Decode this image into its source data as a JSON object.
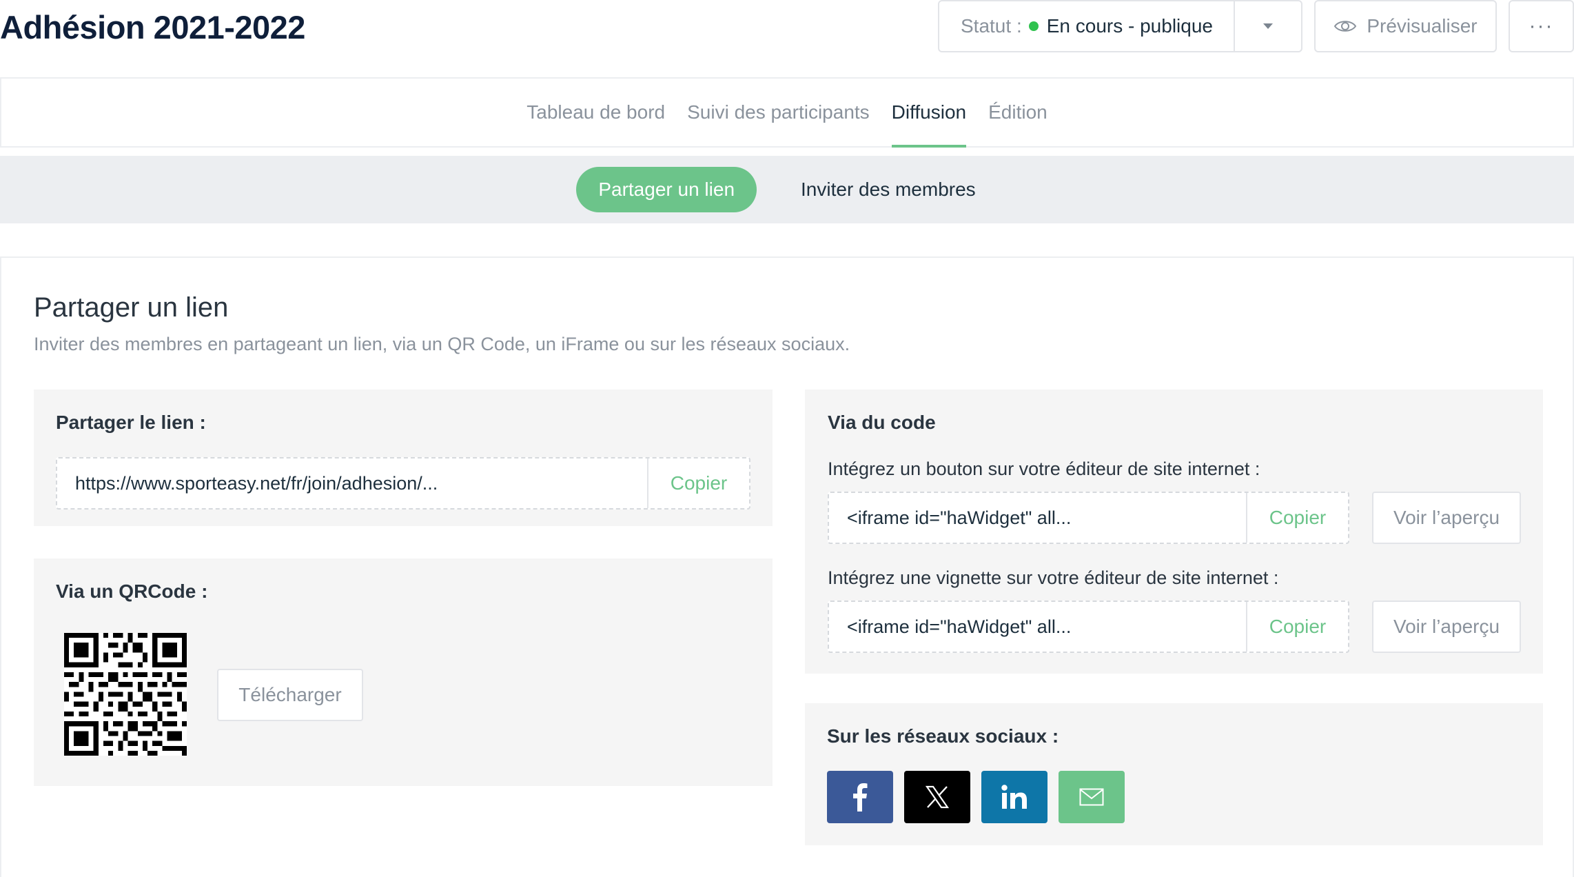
{
  "header": {
    "title": "Adhésion 2021-2022",
    "status_label": "Statut :",
    "status_value": "En cours - publique",
    "status_color": "#30c24f",
    "preview_label": "Prévisualiser",
    "more_label": "···"
  },
  "tabs": [
    {
      "label": "Tableau de bord",
      "active": false
    },
    {
      "label": "Suivi des participants",
      "active": false
    },
    {
      "label": "Diffusion",
      "active": true
    },
    {
      "label": "Édition",
      "active": false
    }
  ],
  "subnav": {
    "active_label": "Partager un lien",
    "other_label": "Inviter des membres"
  },
  "share": {
    "title": "Partager un lien",
    "subtitle": "Inviter des membres en partageant un lien, via un QR Code, un iFrame ou sur les réseaux sociaux.",
    "link_panel": {
      "label": "Partager le lien :",
      "value": "https://www.sporteasy.net/fr/join/adhesion/...",
      "copy_label": "Copier"
    },
    "qr_panel": {
      "label": "Via un QRCode :",
      "download_label": "Télécharger"
    },
    "code_panel": {
      "label": "Via du code",
      "button_label": "Intégrez un bouton sur votre éditeur de site internet :",
      "button_value": "<iframe id=\"haWidget\" all...",
      "vignette_label": "Intégrez une vignette sur votre éditeur de site internet :",
      "vignette_value": "<iframe id=\"haWidget\" all...",
      "copy_label": "Copier",
      "preview_label": "Voir l’aperçu"
    },
    "social_panel": {
      "label": "Sur les réseaux sociaux :",
      "networks": [
        {
          "icon": "facebook-icon",
          "color": "#3b5998"
        },
        {
          "icon": "x-icon",
          "color": "#000000"
        },
        {
          "icon": "linkedin-icon",
          "color": "#0e76a8"
        },
        {
          "icon": "email-icon",
          "color": "#6cc48a"
        }
      ]
    }
  },
  "colors": {
    "accent": "#6cc48a",
    "title": "#0f1f3a",
    "muted": "#8a929c"
  }
}
